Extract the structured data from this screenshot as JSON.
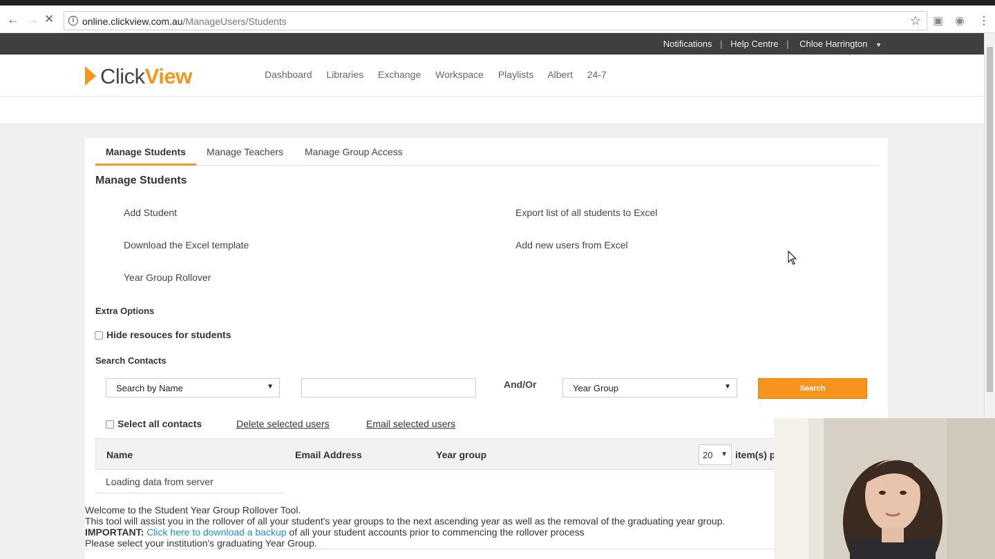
{
  "browser": {
    "url_host": "online.clickview.com.au",
    "url_path": "/ManageUsers/Students"
  },
  "topnav": {
    "notifications": "Notifications",
    "help": "Help Centre",
    "user": "Chloe Harrington"
  },
  "logo": {
    "part1": "Click",
    "part2": "View"
  },
  "mainnav": [
    "Dashboard",
    "Libraries",
    "Exchange",
    "Workspace",
    "Playlists",
    "Albert",
    "24-7"
  ],
  "tabs": [
    "Manage Students",
    "Manage Teachers",
    "Manage Group Access"
  ],
  "page_title": "Manage Students",
  "actions": {
    "add_student": "Add Student",
    "download_template": "Download the Excel template",
    "year_rollover": "Year Group Rollover",
    "export_excel": "Export list of all students to Excel",
    "add_from_excel": "Add new users from Excel"
  },
  "extra_options": {
    "label": "Extra Options",
    "hide_resources": "Hide resouces for students"
  },
  "search": {
    "label": "Search Contacts",
    "by_select": "Search by Name",
    "input_value": "",
    "andor": "And/Or",
    "year_select": "Year Group",
    "button": "Search"
  },
  "bulk": {
    "select_all": "Select all contacts",
    "delete": "Delete selected users",
    "email": "Email selected users"
  },
  "table": {
    "headers": [
      "Name",
      "Email Address",
      "Year group"
    ],
    "per_page_value": "20",
    "per_page_label": "item(s) p",
    "loading": "Loading data from server"
  },
  "rollover_text": {
    "line1": "Welcome to the Student Year Group Rollover Tool.",
    "line2": "This tool will assist you in the rollover of all your student's year groups to the next ascending year as well as the removal of the graduating year group.",
    "important": "IMPORTANT:",
    "backup_link": "Click here to download a backup",
    "line3_rest": " of all your student accounts prior to commencing the rollover process",
    "line4": "Please select your institution's graduating Year Group."
  },
  "colors": {
    "accent": "#f7941d",
    "link": "#1a8fd0",
    "topbar": "#3f3f3f"
  }
}
